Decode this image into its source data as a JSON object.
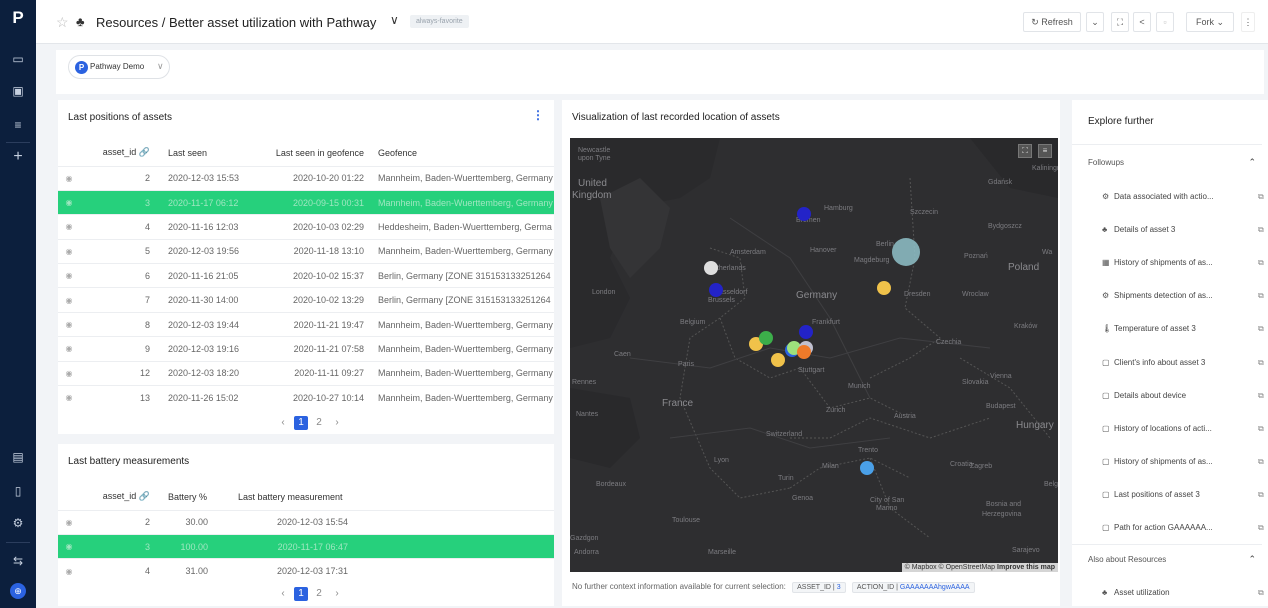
{
  "app": {
    "logo_glyph": "P",
    "title": "Resources / Better asset utilization with Pathway",
    "favorite_badge": "always-favorite",
    "toolbar": {
      "refresh_label": "Refresh",
      "fork_label": "Fork"
    }
  },
  "filter": {
    "selected": "Pathway Demo"
  },
  "positions_panel": {
    "title": "Last positions of assets",
    "columns": [
      "asset_id",
      "Last seen",
      "Last seen in geofence",
      "Geofence"
    ],
    "rows": [
      [
        "2",
        "2020-12-03 15:53",
        "2020-10-20 01:22",
        "Mannheim, Baden-Wuerttemberg, Germany"
      ],
      [
        "3",
        "2020-11-17 06:12",
        "2020-09-15 00:31",
        "Mannheim, Baden-Wuerttemberg, Germany"
      ],
      [
        "4",
        "2020-11-16 12:03",
        "2020-10-03 02:29",
        "Heddesheim, Baden-Wuerttemberg, Germa"
      ],
      [
        "5",
        "2020-12-03 19:56",
        "2020-11-18 13:10",
        "Mannheim, Baden-Wuerttemberg, Germany"
      ],
      [
        "6",
        "2020-11-16 21:05",
        "2020-10-02 15:37",
        "Berlin, Germany [ZONE 315153133251264"
      ],
      [
        "7",
        "2020-11-30 14:00",
        "2020-10-02 13:29",
        "Berlin, Germany [ZONE 315153133251264"
      ],
      [
        "8",
        "2020-12-03 19:44",
        "2020-11-21 19:47",
        "Mannheim, Baden-Wuerttemberg, Germany"
      ],
      [
        "9",
        "2020-12-03 19:16",
        "2020-11-21 07:58",
        "Mannheim, Baden-Wuerttemberg, Germany"
      ],
      [
        "12",
        "2020-12-03 18:20",
        "2020-11-11 09:27",
        "Mannheim, Baden-Wuerttemberg, Germany"
      ],
      [
        "13",
        "2020-11-26 15:02",
        "2020-10-27 10:14",
        "Mannheim, Baden-Wuerttemberg, Germany"
      ]
    ],
    "selected_row": 1,
    "pager": {
      "current": "1",
      "next": "2"
    }
  },
  "battery_panel": {
    "title": "Last battery measurements",
    "columns": [
      "asset_id",
      "Battery %",
      "Last battery measurement"
    ],
    "rows": [
      [
        "2",
        "30.00",
        "2020-12-03 15:54"
      ],
      [
        "3",
        "100.00",
        "2020-11-17 06:47"
      ],
      [
        "4",
        "31.00",
        "2020-12-03 17:31"
      ]
    ],
    "selected_row": 1,
    "pager": {
      "current": "1",
      "next": "2"
    }
  },
  "map_panel": {
    "title": "Visualization of last recorded location of assets",
    "attribution": "© Mapbox © OpenStreetMap",
    "attribution_link": "Improve this map",
    "labels": [
      {
        "text": "Newcastle",
        "size": "s"
      },
      {
        "text": "upon Tyne",
        "size": "s"
      },
      {
        "text": "United",
        "size": "m"
      },
      {
        "text": "Kingdom",
        "size": "m"
      },
      {
        "text": "Hamburg",
        "size": "s"
      },
      {
        "text": "Bremen",
        "size": "s"
      },
      {
        "text": "Szczecin",
        "size": "s"
      },
      {
        "text": "Gdańsk",
        "size": "s"
      },
      {
        "text": "Kaliningr",
        "size": "s"
      },
      {
        "text": "Bydgoszcz",
        "size": "s"
      },
      {
        "text": "Amsterdam",
        "size": "s"
      },
      {
        "text": "Hanover",
        "size": "s"
      },
      {
        "text": "Berlin",
        "size": "s"
      },
      {
        "text": "Magdeburg",
        "size": "s"
      },
      {
        "text": "Poznań",
        "size": "s"
      },
      {
        "text": "Poland",
        "size": "m"
      },
      {
        "text": "Wa",
        "size": "s"
      },
      {
        "text": "Netherlands",
        "size": "s"
      },
      {
        "text": "London",
        "size": "s"
      },
      {
        "text": "Düsseldorf",
        "size": "s"
      },
      {
        "text": "Dresden",
        "size": "s"
      },
      {
        "text": "Wroclaw",
        "size": "s"
      },
      {
        "text": "Brussels",
        "size": "s"
      },
      {
        "text": "Germany",
        "size": "m"
      },
      {
        "text": "Belgium",
        "size": "s"
      },
      {
        "text": "Frankfurt",
        "size": "s"
      },
      {
        "text": "Kraków",
        "size": "s"
      },
      {
        "text": "Caen",
        "size": "s"
      },
      {
        "text": "Paris",
        "size": "s"
      },
      {
        "text": "Stuttgart",
        "size": "s"
      },
      {
        "text": "Czechia",
        "size": "s"
      },
      {
        "text": "Rennes",
        "size": "s"
      },
      {
        "text": "Munich",
        "size": "s"
      },
      {
        "text": "Vienna",
        "size": "s"
      },
      {
        "text": "Slovakia",
        "size": "s"
      },
      {
        "text": "France",
        "size": "m"
      },
      {
        "text": "Zurich",
        "size": "s"
      },
      {
        "text": "Austria",
        "size": "s"
      },
      {
        "text": "Budapest",
        "size": "s"
      },
      {
        "text": "Nantes",
        "size": "s"
      },
      {
        "text": "Switzerland",
        "size": "s"
      },
      {
        "text": "Hungary",
        "size": "m"
      },
      {
        "text": "Lyon",
        "size": "s"
      },
      {
        "text": "Trento",
        "size": "s"
      },
      {
        "text": "Zagreb",
        "size": "s"
      },
      {
        "text": "Milan",
        "size": "s"
      },
      {
        "text": "Croatia",
        "size": "s"
      },
      {
        "text": "Bordeaux",
        "size": "s"
      },
      {
        "text": "Turin",
        "size": "s"
      },
      {
        "text": "Genoa",
        "size": "s"
      },
      {
        "text": "Bosnia and",
        "size": "s"
      },
      {
        "text": "Herzegovina",
        "size": "s"
      },
      {
        "text": "Belgra",
        "size": "s"
      },
      {
        "text": "Toulouse",
        "size": "s"
      },
      {
        "text": "City of San",
        "size": "s"
      },
      {
        "text": "Marino",
        "size": "s"
      },
      {
        "text": "Marseille",
        "size": "s"
      },
      {
        "text": "Sarajevo",
        "size": "s"
      },
      {
        "text": "Gazdgon",
        "size": "s"
      },
      {
        "text": "Andorra",
        "size": "s"
      }
    ],
    "context_text": "No further context information available for current selection:",
    "chips": [
      {
        "key": "ASSET_ID",
        "value": "3"
      },
      {
        "key": "ACTION_ID",
        "value": "GAAAAAAAhgwAAAA"
      }
    ]
  },
  "explore": {
    "title": "Explore further",
    "followups_header": "Followups",
    "followups": [
      {
        "label": "Data associated with actio...",
        "icon": "gears-icon"
      },
      {
        "label": "Details of asset 3",
        "icon": "resources-icon"
      },
      {
        "label": "History of shipments of as...",
        "icon": "calendar-icon"
      },
      {
        "label": "Shipments detection of as...",
        "icon": "gears-icon"
      },
      {
        "label": "Temperature of asset 3",
        "icon": "thermometer-icon"
      },
      {
        "label": "Client's info about asset 3",
        "icon": "table-icon"
      },
      {
        "label": "Details about device",
        "icon": "table-icon"
      },
      {
        "label": "History of locations of acti...",
        "icon": "table-icon"
      },
      {
        "label": "History of shipments of as...",
        "icon": "table-icon"
      },
      {
        "label": "Last positions of asset 3",
        "icon": "table-icon"
      },
      {
        "label": "Path for action GAAAAAA...",
        "icon": "table-icon"
      }
    ],
    "also_header": "Also about Resources",
    "also": [
      {
        "label": "Asset utilization",
        "icon": "resources-icon"
      }
    ]
  },
  "colors": {
    "rail": "#0c1f3d",
    "accent": "#2b62e0",
    "selected_row": "#26d07c",
    "map_bg": "#2e2e30"
  },
  "markers": [
    {
      "color": "#2323c8",
      "size": 1
    },
    {
      "color": "#8fc1c9",
      "size": 3
    },
    {
      "color": "#dedede",
      "size": 1
    },
    {
      "color": "#2323c8",
      "size": 1
    },
    {
      "color": "#f0c24a",
      "size": 1
    },
    {
      "color": "#2323c8",
      "size": 1
    },
    {
      "color": "#f0c24a",
      "size": 1
    },
    {
      "color": "#3cae4a",
      "size": 1
    },
    {
      "color": "#f0c24a",
      "size": 1
    },
    {
      "color": "#2b62e0",
      "size": 1
    },
    {
      "color": "#9ee07c",
      "size": 1
    },
    {
      "color": "#c0c0d0",
      "size": 1
    },
    {
      "color": "#ee7a2a",
      "size": 1
    },
    {
      "color": "#4aa0e8",
      "size": 1
    }
  ]
}
